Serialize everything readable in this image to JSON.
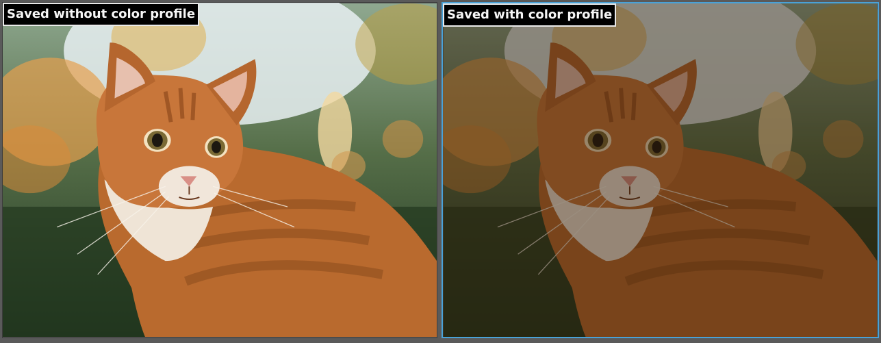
{
  "comparison": {
    "left": {
      "caption": "Saved without color profile",
      "image": "orange tabby cat photo (flat, lighter rendering)"
    },
    "right": {
      "caption": "Saved with color profile",
      "image": "orange tabby cat photo (darker, more saturated rendering)"
    }
  },
  "colors": {
    "background": "#5a5a5a",
    "selected_border": "#49a2d8",
    "caption_bg": "#000000",
    "caption_text": "#f6f6f6"
  }
}
